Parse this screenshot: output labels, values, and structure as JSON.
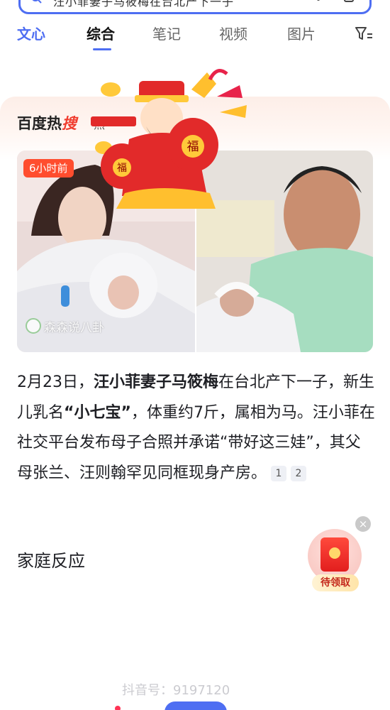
{
  "search": {
    "query": "汪小菲妻子马筱梅在台北产下一子"
  },
  "tabs": [
    {
      "label": "文心"
    },
    {
      "label": "综合"
    },
    {
      "label": "笔记"
    },
    {
      "label": "视频"
    },
    {
      "label": "图片"
    }
  ],
  "hot": {
    "logo_part1": "百度热",
    "logo_part2": "搜",
    "sub": "热"
  },
  "photo": {
    "time_badge": "6小时前",
    "watermark": "森森说八卦"
  },
  "article": {
    "p1": "2月23日，",
    "b1": "汪小菲妻子马筱梅",
    "p2": "在台北产下一子，新生儿乳名",
    "b2": "“小七宝”",
    "p3": "，体重约7斤，属相为马。汪小菲在社交平台发布母子合照并承诺“带好这三娃”，其父母张兰、汪则翰罕见同框现身产房。",
    "cite1": "1",
    "cite2": "2"
  },
  "section": {
    "title": "家庭反应"
  },
  "envelope": {
    "label": "待领取",
    "close": "×",
    "seal": "福"
  },
  "footer": {
    "watermark": "抖音号：9197120"
  },
  "colors": {
    "brand": "#4e6ef2",
    "hot_red": "#f03c2e",
    "badge": "#ff4d2e"
  }
}
